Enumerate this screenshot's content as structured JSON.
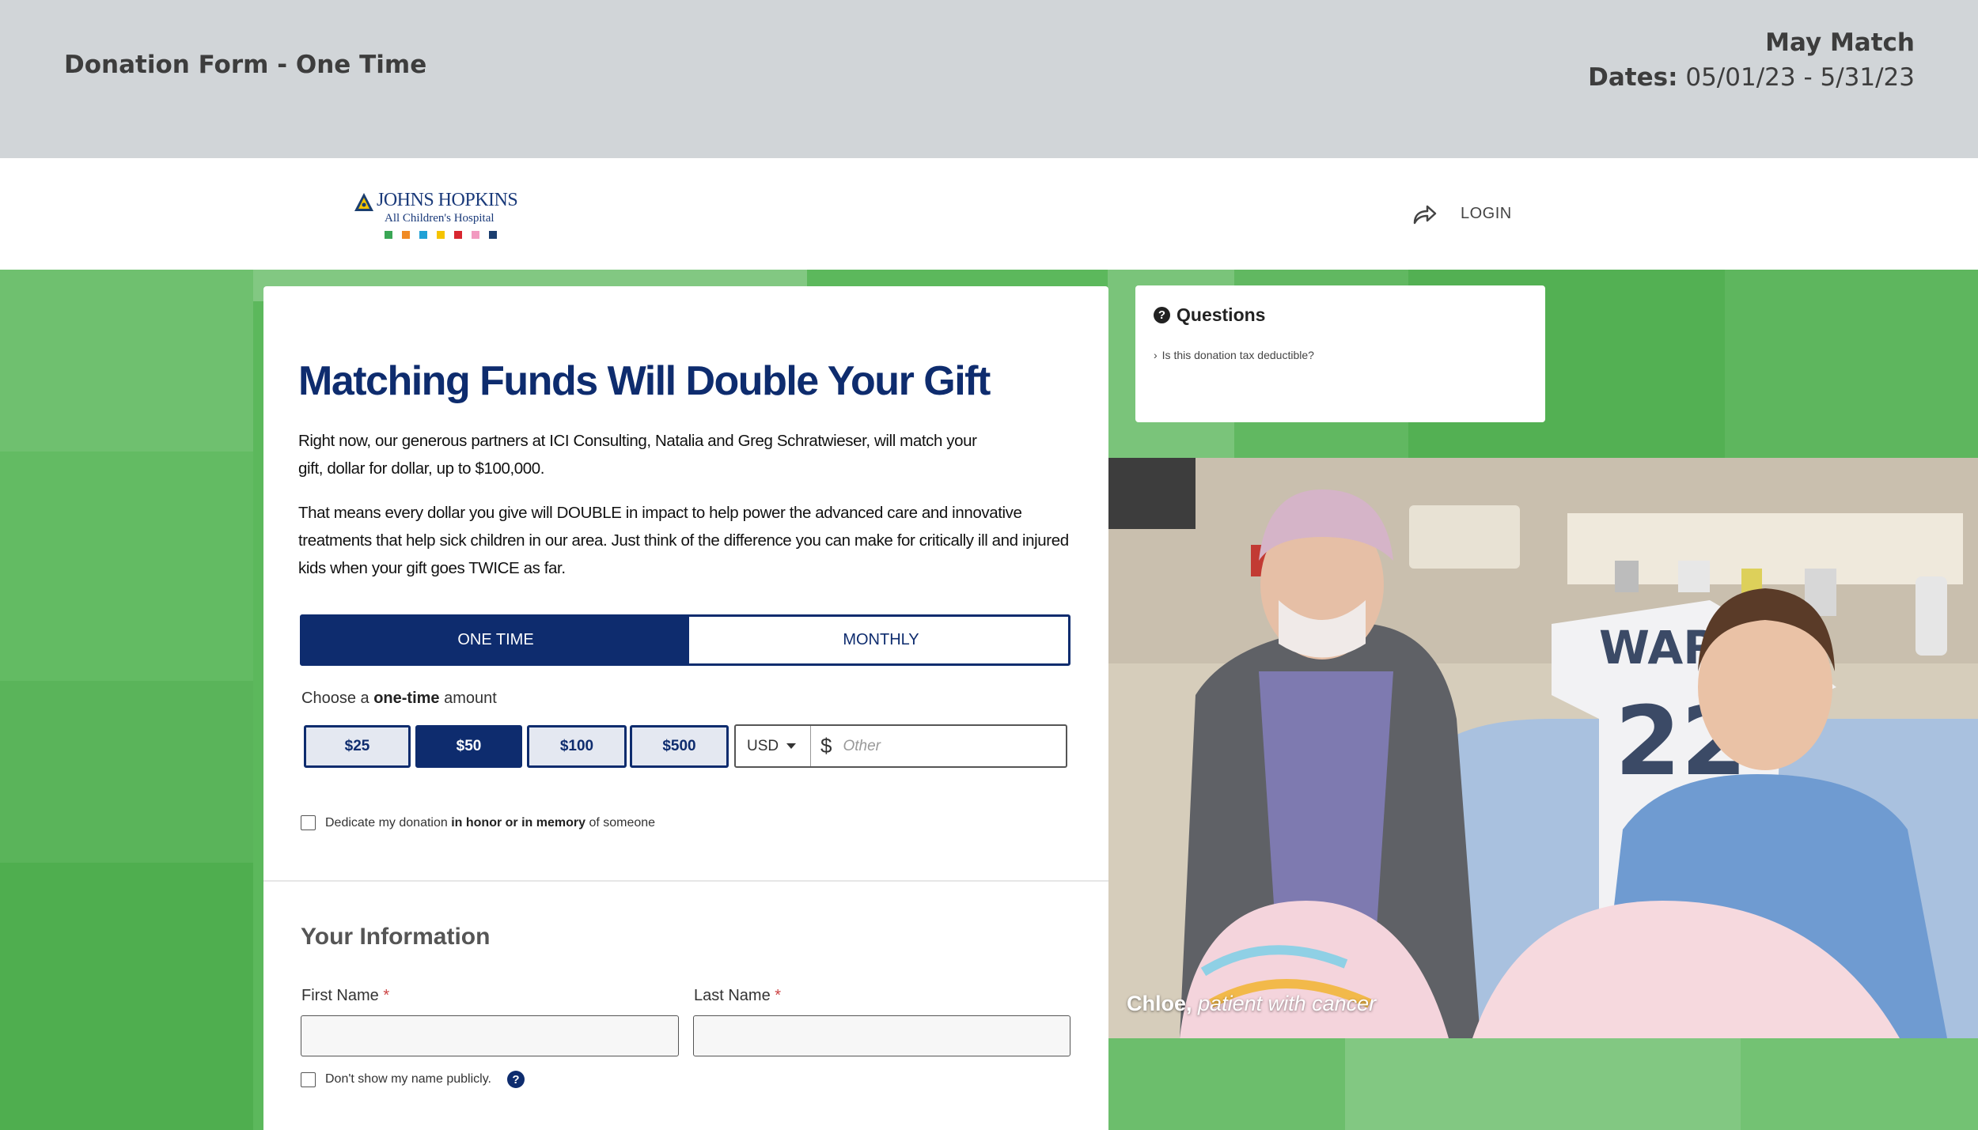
{
  "banner": {
    "title": "Donation Form - One Time",
    "campaign": "May Match",
    "dates_label": "Dates:",
    "dates_value": "05/01/23 - 5/31/23"
  },
  "header": {
    "logo_name": "JOHNS HOPKINS",
    "logo_subname": "All Children's Hospital",
    "logo_dot_colors": [
      "#3aa655",
      "#f08a24",
      "#1fa1d6",
      "#f5c400",
      "#d8262f",
      "#f29ac0",
      "#1b3e6f"
    ],
    "login_label": "LOGIN"
  },
  "form": {
    "headline": "Matching Funds Will Double Your Gift",
    "paragraph1": "Right now, our generous partners at ICI Consulting, Natalia and Greg Schratwieser, will match your gift, dollar for dollar, up to $100,000.",
    "paragraph2": "That means every dollar you give will DOUBLE in impact to help power the advanced care and innovative treatments that help sick children in our area. Just think of the difference you can make for critically ill and injured kids when your gift goes TWICE as far.",
    "frequency": {
      "one_time": "ONE TIME",
      "monthly": "MONTHLY",
      "selected": "ONE TIME"
    },
    "choose_prefix": "Choose a",
    "choose_bold": "one-time",
    "choose_suffix": "amount",
    "amounts": [
      "$25",
      "$50",
      "$100",
      "$500"
    ],
    "selected_amount": "$50",
    "currency": "USD",
    "currency_symbol": "$",
    "other_placeholder": "Other",
    "dedicate_prefix": "Dedicate my donation",
    "dedicate_bold": "in honor or in memory",
    "dedicate_suffix": "of someone",
    "your_info_title": "Your Information",
    "first_name_label": "First Name",
    "last_name_label": "Last Name",
    "required_mark": "*",
    "hide_name_label": "Don't show my name publicly.",
    "help_icon": "?"
  },
  "questions": {
    "title": "Questions",
    "icon": "?",
    "items": [
      "Is this donation tax deductible?"
    ]
  },
  "photo": {
    "caption_name": "Chloe,",
    "caption_desc": "patient with cancer"
  },
  "colors": {
    "navy": "#0e2c6e",
    "green": "#5cb85c",
    "banner_gray": "#d1d5d8"
  }
}
